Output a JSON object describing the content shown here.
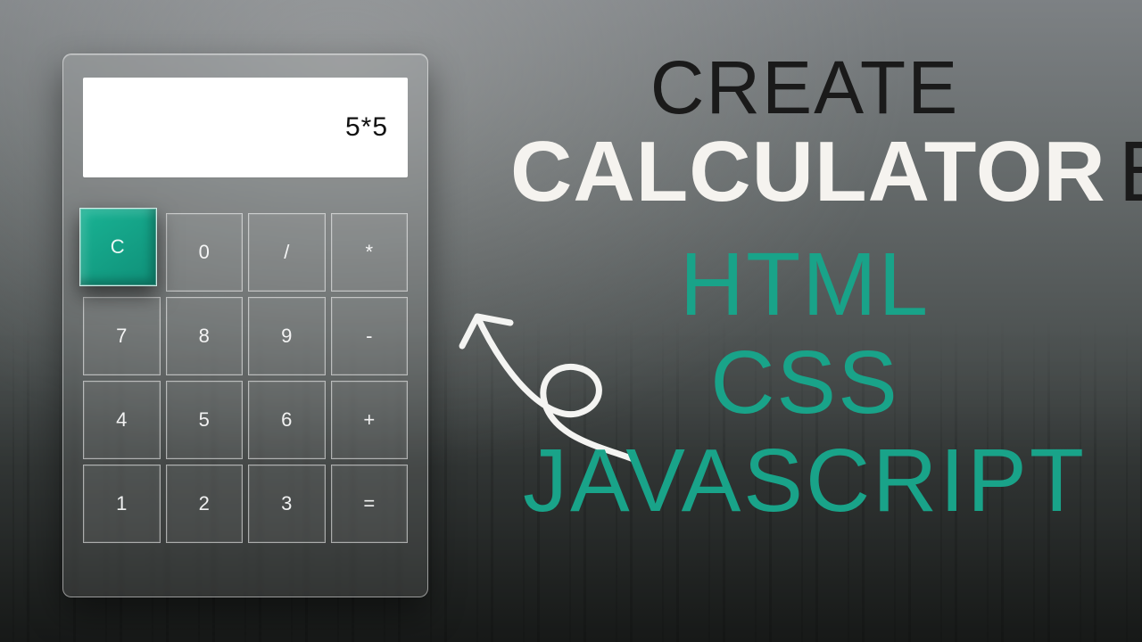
{
  "calculator": {
    "display_value": "5*5",
    "keys": [
      {
        "id": "clear",
        "label": "C",
        "kind": "clear",
        "span": 1
      },
      {
        "id": "digit-0",
        "label": "0",
        "kind": "digit",
        "span": 1
      },
      {
        "id": "divide",
        "label": "/",
        "kind": "operator",
        "span": 1
      },
      {
        "id": "multiply",
        "label": "*",
        "kind": "operator",
        "span": 1
      },
      {
        "id": "digit-7",
        "label": "7",
        "kind": "digit",
        "span": 1
      },
      {
        "id": "digit-8",
        "label": "8",
        "kind": "digit",
        "span": 1
      },
      {
        "id": "digit-9",
        "label": "9",
        "kind": "digit",
        "span": 1
      },
      {
        "id": "subtract",
        "label": "-",
        "kind": "operator",
        "span": 1
      },
      {
        "id": "digit-4",
        "label": "4",
        "kind": "digit",
        "span": 1
      },
      {
        "id": "digit-5",
        "label": "5",
        "kind": "digit",
        "span": 1
      },
      {
        "id": "digit-6",
        "label": "6",
        "kind": "digit",
        "span": 1
      },
      {
        "id": "add",
        "label": "+",
        "kind": "operator",
        "span": 1
      },
      {
        "id": "digit-1",
        "label": "1",
        "kind": "digit",
        "span": 1
      },
      {
        "id": "digit-2",
        "label": "2",
        "kind": "digit",
        "span": 1
      },
      {
        "id": "digit-3",
        "label": "3",
        "kind": "digit",
        "span": 1
      },
      {
        "id": "equals",
        "label": "=",
        "kind": "equals",
        "span": 1
      }
    ]
  },
  "headline": {
    "line1": "CREATE",
    "bold": "CALCULATOR",
    "by": "BY",
    "line3": "HTML",
    "line4": "CSS",
    "line5": "JAVASCRIPT"
  },
  "colors": {
    "teal": "#19a389",
    "clear_button": "#16a085",
    "title_dark": "#1a1a1a",
    "title_light": "#f5f3ef"
  }
}
